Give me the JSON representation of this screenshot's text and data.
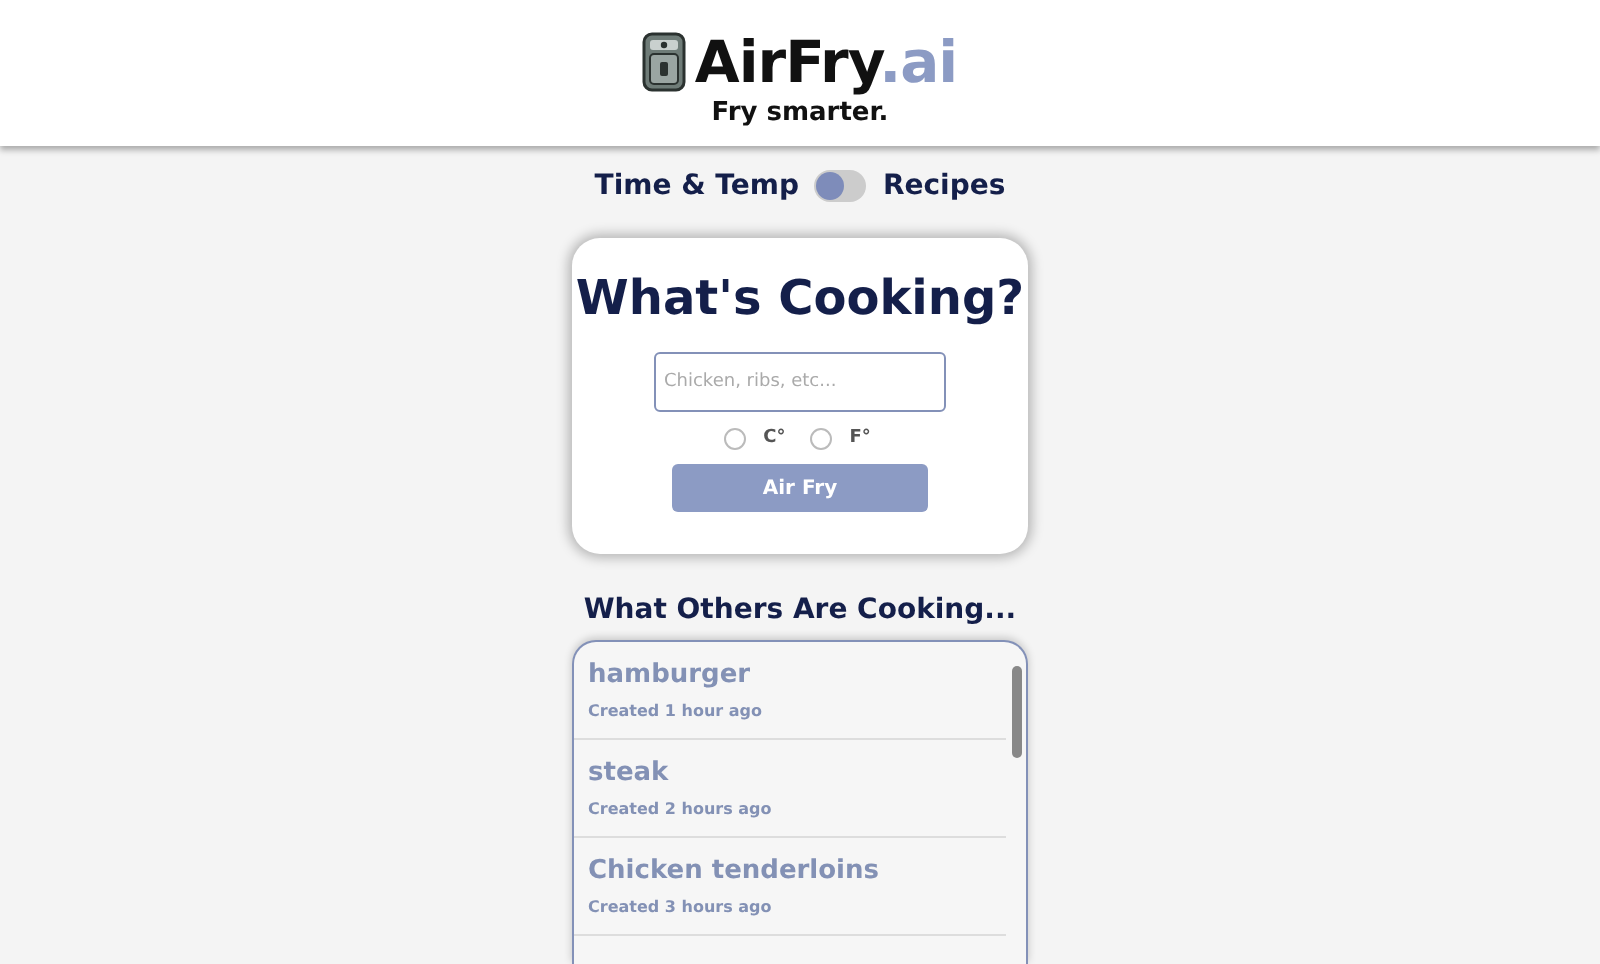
{
  "header": {
    "logo_main": "AirFry",
    "logo_accent": ".ai",
    "tagline": "Fry smarter."
  },
  "mode_toggle": {
    "left_label": "Time & Temp",
    "right_label": "Recipes",
    "on": false
  },
  "search_card": {
    "title": "What's Cooking?",
    "placeholder": "Chicken, ribs, etc...",
    "units": [
      {
        "label": "C°",
        "selected": false
      },
      {
        "label": "F°",
        "selected": false
      }
    ],
    "button": "Air Fry"
  },
  "recent": {
    "title": "What Others Are Cooking...",
    "items": [
      {
        "name": "hamburger",
        "created": "Created 1 hour ago"
      },
      {
        "name": "steak",
        "created": "Created 2 hours ago"
      },
      {
        "name": "Chicken tenderloins",
        "created": "Created 3 hours ago"
      }
    ]
  }
}
